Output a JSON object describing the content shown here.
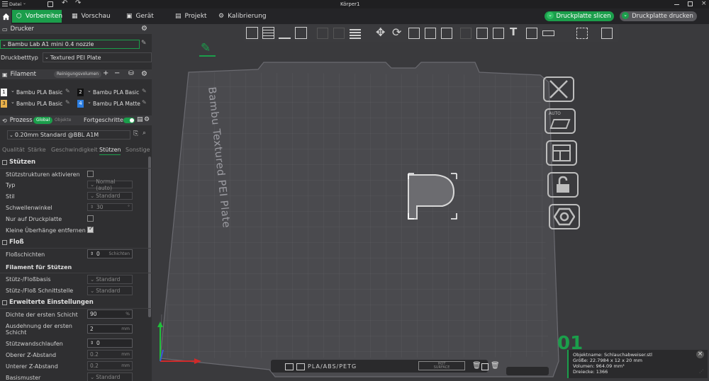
{
  "titlebar": {
    "menu_label": "Datei",
    "window_title": "Körper1"
  },
  "tabs": [
    {
      "label": "Vorbereiten",
      "active": true
    },
    {
      "label": "Vorschau",
      "active": false
    },
    {
      "label": "Gerät",
      "active": false
    },
    {
      "label": "Projekt",
      "active": false
    },
    {
      "label": "Kalibrierung",
      "active": false
    }
  ],
  "actions": {
    "slice_label": "Druckplatte slicen",
    "print_label": "Druckplatte drucken"
  },
  "printer": {
    "section_title": "Drucker",
    "printer_name": "Bambu Lab A1 mini 0.4 nozzle",
    "bed_type_label": "Druckbetttyp",
    "bed_type_value": "Textured PEI Plate"
  },
  "filament": {
    "section_title": "Filament",
    "cleaning_button": "Reinigungsvolumen",
    "slots": [
      {
        "num": "1",
        "name": "Bambu PLA Basic",
        "color": "#f4f4f4",
        "numColor": "#222"
      },
      {
        "num": "2",
        "name": "Bambu PLA Basic",
        "color": "#111111",
        "numColor": "#fff"
      },
      {
        "num": "3",
        "name": "Bambu PLA Basic",
        "color": "#e8b04a",
        "numColor": "#222"
      },
      {
        "num": "4",
        "name": "Bambu PLA Matte",
        "color": "#2b7de0",
        "numColor": "#fff"
      }
    ]
  },
  "process": {
    "section_title": "Prozess",
    "global_label": "Global",
    "objects_label": "Objekte",
    "advanced_label": "Fortgeschritten",
    "profile": "0.20mm Standard @BBL A1M",
    "subtabs": [
      "Qualität",
      "Stärke",
      "Geschwindigkeit",
      "Stützen",
      "Sonstige"
    ]
  },
  "support": {
    "title": "Stützen",
    "enable_label": "Stützstrukturen aktivieren",
    "type_label": "Typ",
    "type_value": "Normal (auto)",
    "style_label": "Stil",
    "style_value": "Standard",
    "threshold_label": "Schwellenwinkel",
    "threshold_value": "30",
    "buildplate_only_label": "Nur auf Druckplatte",
    "remove_small_label": "Kleine Überhänge entfernen"
  },
  "raft": {
    "title": "Floß",
    "layers_label": "Floßschichten",
    "layers_value": "0",
    "layers_unit": "Schichten"
  },
  "support_filament": {
    "title": "Filament für Stützen",
    "base_label": "Stütz-/Floßbasis",
    "base_value": "Standard",
    "interface_label": "Stütz-/Floß Schnittstelle",
    "interface_value": "Standard"
  },
  "advanced": {
    "title": "Erweiterte Einstellungen",
    "initial_density_label": "Dichte der ersten Schicht",
    "initial_density_value": "90",
    "initial_density_unit": "%",
    "expansion_label_1": "Ausdehnung der ersten",
    "expansion_label_2": "Schicht",
    "expansion_value": "2",
    "expansion_unit": "mm",
    "wall_loops_label": "Stützwandschlaufen",
    "wall_loops_value": "0",
    "top_z_label": "Oberer Z-Abstand",
    "top_z_value": "0.2",
    "top_z_unit": "mm",
    "bottom_z_label": "Unterer Z-Abstand",
    "bottom_z_value": "0.2",
    "bottom_z_unit": "mm",
    "base_pattern_label": "Basismuster",
    "base_pattern_value": "Standard"
  },
  "plate": {
    "plate_label": "Bambu Textured PEI Plate",
    "footer_text": "PLA/ABS/PETG",
    "surface_text_1": "HOT",
    "surface_text_2": "SURFACE",
    "number": "01"
  },
  "object_info": {
    "name": "Objektname: Schlauchabweiser.stl",
    "size": "Größe: 22.7984 x 12 x 20 mm",
    "volume": "Volumen: 964.09 mm³",
    "triangles": "Dreiecke: 1366"
  },
  "colors": {
    "accent": "#1b9e4b",
    "panel": "#2f2f31",
    "viewport": "#3a3a3d",
    "plate": "#4e4e52"
  }
}
